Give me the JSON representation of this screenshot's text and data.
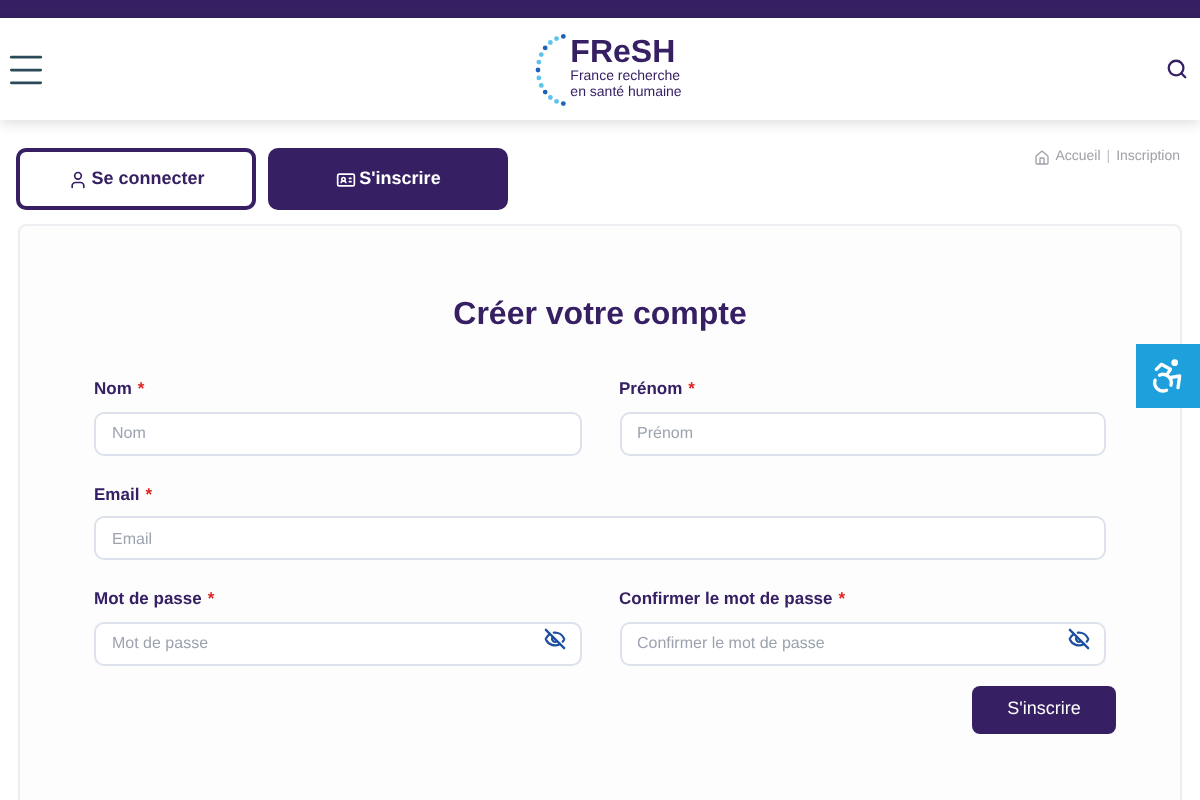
{
  "header": {
    "logo_title": "FReSH",
    "logo_subtitle_1": "France recherche",
    "logo_subtitle_2": "en santé humaine"
  },
  "tabs": [
    {
      "label": "Se connecter",
      "selected": false,
      "kind": "user"
    },
    {
      "label": "S'inscrire",
      "selected": true,
      "kind": "card"
    }
  ],
  "breadcrumb": {
    "items": [
      "Accueil",
      "Inscription"
    ],
    "separator": "|"
  },
  "form": {
    "title": "Créer votre compte",
    "rows": [
      [
        {
          "label": "Nom",
          "required_mark": "*",
          "placeholder": "Nom",
          "kind": "text"
        },
        {
          "label": "Prénom",
          "required_mark": "*",
          "placeholder": "Prénom",
          "kind": "text"
        }
      ],
      [
        {
          "label": "Email",
          "required_mark": "*",
          "placeholder": "Email",
          "kind": "text"
        }
      ],
      [
        {
          "label": "Mot de passe",
          "required_mark": "*",
          "placeholder": "Mot de passe",
          "kind": "password"
        },
        {
          "label": "Confirmer le mot de passe",
          "required_mark": "*",
          "placeholder": "Confirmer le mot de passe",
          "kind": "password"
        }
      ]
    ],
    "submit": "S'inscrire"
  }
}
